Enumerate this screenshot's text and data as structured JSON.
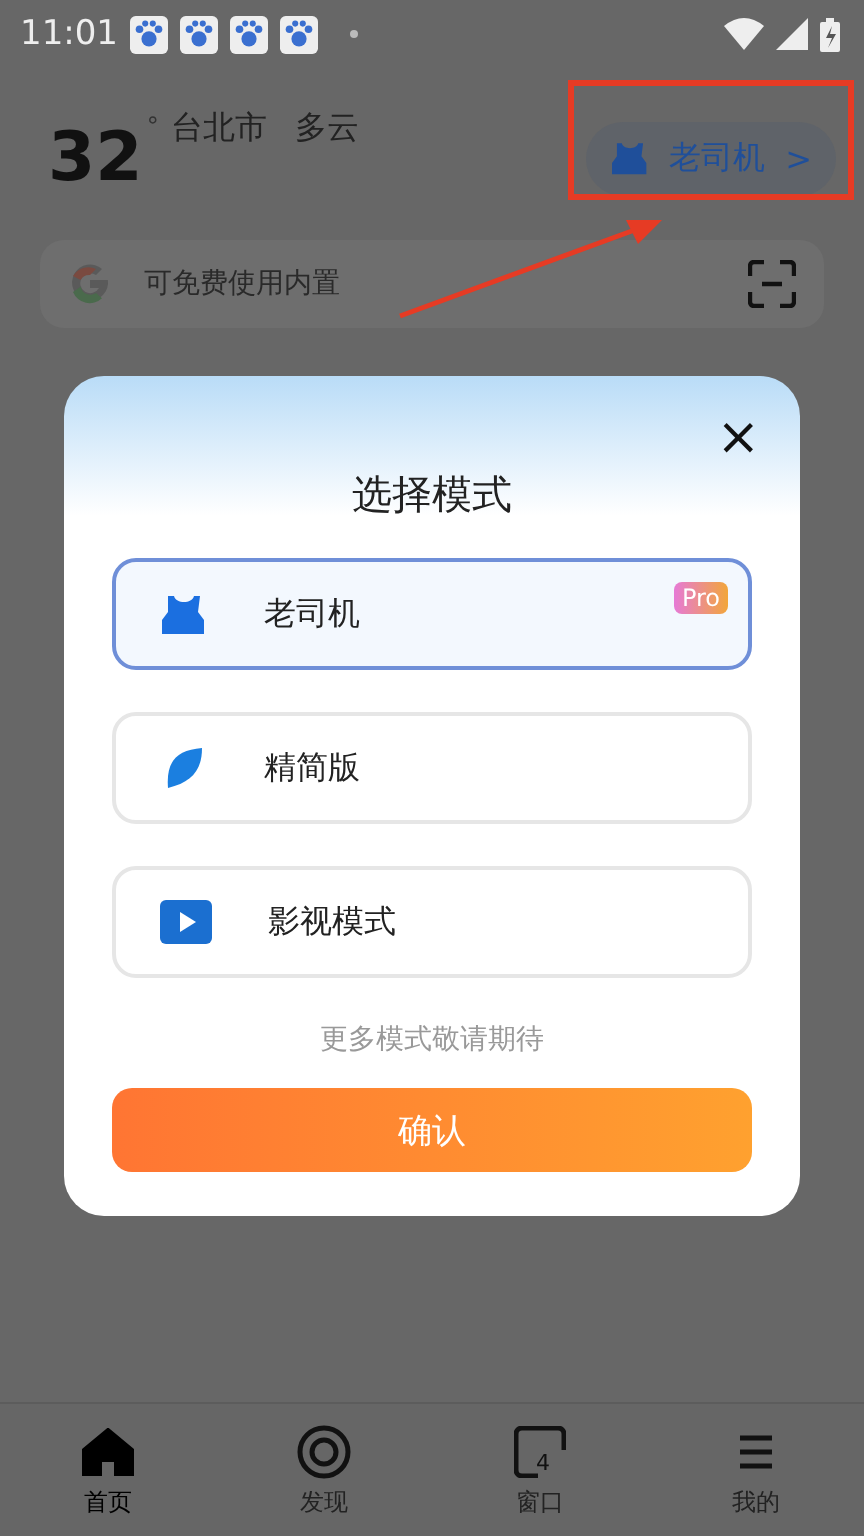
{
  "status_bar": {
    "time": "11:01",
    "notifications": [
      {
        "kind": "paw"
      },
      {
        "kind": "paw"
      },
      {
        "kind": "paw"
      },
      {
        "kind": "paw"
      }
    ]
  },
  "header": {
    "temperature": "32",
    "unit": "°",
    "city": "台北市",
    "weather": "多云",
    "mode_chip": {
      "label": "老司机",
      "chevron": ">"
    }
  },
  "search": {
    "placeholder": "可免费使用内置"
  },
  "dialog": {
    "title": "选择模式",
    "close": "×",
    "options": [
      {
        "kind": "top",
        "label": "老司机",
        "badge": "Pro",
        "selected": true
      },
      {
        "kind": "leaf",
        "label": "精简版",
        "selected": false
      },
      {
        "kind": "video",
        "label": "影视模式",
        "selected": false
      }
    ],
    "note": "更多模式敬请期待",
    "confirm": "确认"
  },
  "nav": [
    {
      "kind": "home",
      "label": "首页",
      "selected": true
    },
    {
      "kind": "discover",
      "label": "发现",
      "selected": false
    },
    {
      "kind": "window",
      "label": "窗口",
      "count": "4",
      "selected": false
    },
    {
      "kind": "menu",
      "label": "我的",
      "selected": false
    }
  ]
}
